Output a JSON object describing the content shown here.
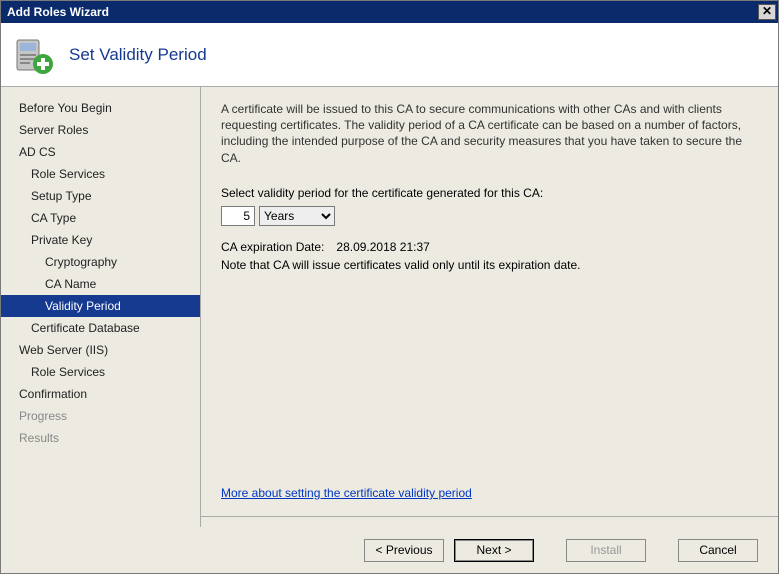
{
  "window": {
    "title": "Add Roles Wizard"
  },
  "header": {
    "title": "Set Validity Period"
  },
  "sidebar": {
    "items": [
      {
        "label": "Before You Begin",
        "level": 0
      },
      {
        "label": "Server Roles",
        "level": 0
      },
      {
        "label": "AD CS",
        "level": 0
      },
      {
        "label": "Role Services",
        "level": 1
      },
      {
        "label": "Setup Type",
        "level": 1
      },
      {
        "label": "CA Type",
        "level": 1
      },
      {
        "label": "Private Key",
        "level": 1
      },
      {
        "label": "Cryptography",
        "level": 2
      },
      {
        "label": "CA Name",
        "level": 2
      },
      {
        "label": "Validity Period",
        "level": 2,
        "selected": true
      },
      {
        "label": "Certificate Database",
        "level": 1
      },
      {
        "label": "Web Server (IIS)",
        "level": 0
      },
      {
        "label": "Role Services",
        "level": 1
      },
      {
        "label": "Confirmation",
        "level": 0
      },
      {
        "label": "Progress",
        "level": 0,
        "dim": true
      },
      {
        "label": "Results",
        "level": 0,
        "dim": true
      }
    ]
  },
  "content": {
    "description": "A certificate will be issued to this CA to secure communications with other CAs and with clients requesting certificates. The validity period of a CA certificate can be based on a number of factors, including the intended purpose of the CA and security measures that you have taken to secure the CA.",
    "select_label": "Select validity period for the certificate generated for this CA:",
    "period_value": "5",
    "period_unit": "Years",
    "expiration_label": "CA expiration Date:",
    "expiration_value": "28.09.2018 21:37",
    "note": "Note that CA will issue certificates valid only until its expiration date.",
    "link": "More about setting the certificate validity period"
  },
  "footer": {
    "previous": "< Previous",
    "next": "Next >",
    "install": "Install",
    "cancel": "Cancel"
  }
}
